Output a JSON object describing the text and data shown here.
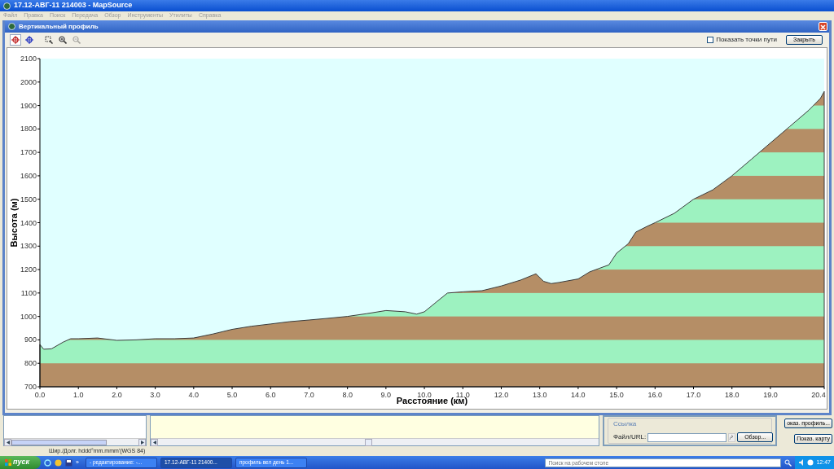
{
  "window": {
    "title": "17.12-АВГ-11 214003 - MapSource"
  },
  "menu": [
    "Файл",
    "Правка",
    "Поиск",
    "Передача",
    "Обзор",
    "Инструменты",
    "Утилиты",
    "Справка"
  ],
  "dialog": {
    "title": "Вертикальный профиль",
    "tools": [
      {
        "kind": "select",
        "selected": true,
        "disabled": false
      },
      {
        "kind": "move",
        "selected": false,
        "disabled": false
      },
      {
        "kind": "zoombox",
        "selected": false,
        "disabled": false
      },
      {
        "kind": "zoomin",
        "selected": false,
        "disabled": false
      },
      {
        "kind": "zoomout",
        "selected": false,
        "disabled": true
      }
    ],
    "show_waypoints": {
      "label": "Показать точки пути",
      "checked": false
    },
    "close_button": "Закрыть",
    "chart_data": {
      "type": "area",
      "xlabel": "Расстояние  (км)",
      "ylabel": "Высота (м)",
      "x": [
        0.0,
        0.1,
        0.3,
        0.6,
        0.8,
        1.0,
        1.5,
        2.0,
        2.5,
        3.0,
        3.5,
        4.0,
        4.5,
        5.0,
        5.5,
        6.0,
        6.5,
        7.0,
        7.5,
        8.0,
        8.5,
        9.0,
        9.5,
        9.8,
        10.0,
        10.3,
        10.6,
        11.0,
        11.5,
        12.0,
        12.5,
        12.9,
        13.1,
        13.3,
        13.5,
        14.0,
        14.3,
        14.8,
        15.0,
        15.3,
        15.5,
        15.8,
        16.0,
        16.5,
        17.0,
        17.5,
        18.0,
        18.5,
        19.0,
        19.5,
        20.0,
        20.3,
        20.4
      ],
      "series": [
        {
          "color": "#3a3a3a",
          "values": [
            880,
            860,
            862,
            890,
            905,
            905,
            908,
            898,
            900,
            905,
            905,
            908,
            925,
            945,
            958,
            968,
            978,
            985,
            992,
            1000,
            1012,
            1025,
            1020,
            1010,
            1020,
            1060,
            1100,
            1105,
            1110,
            1130,
            1155,
            1182,
            1150,
            1140,
            1145,
            1160,
            1190,
            1220,
            1270,
            1310,
            1360,
            1385,
            1400,
            1440,
            1500,
            1540,
            1600,
            1670,
            1740,
            1810,
            1880,
            1930,
            1960
          ]
        }
      ],
      "xlim": [
        0,
        20.4
      ],
      "ylim": [
        700,
        2100
      ],
      "xticks": [
        {
          "value": 0,
          "label": "0.0"
        },
        {
          "value": 1,
          "label": "1.0"
        },
        {
          "value": 2,
          "label": "2.0"
        },
        {
          "value": 3,
          "label": "3.0"
        },
        {
          "value": 4,
          "label": "4.0"
        },
        {
          "value": 5,
          "label": "5.0"
        },
        {
          "value": 6,
          "label": "6.0"
        },
        {
          "value": 7,
          "label": "7.0"
        },
        {
          "value": 8,
          "label": "8.0"
        },
        {
          "value": 9,
          "label": "9.0"
        },
        {
          "value": 10,
          "label": "10.0"
        },
        {
          "value": 11,
          "label": "11.0"
        },
        {
          "value": 12,
          "label": "12.0"
        },
        {
          "value": 13,
          "label": "13.0"
        },
        {
          "value": 14,
          "label": "14.0"
        },
        {
          "value": 15,
          "label": "15.0"
        },
        {
          "value": 16,
          "label": "16.0"
        },
        {
          "value": 17,
          "label": "17.0"
        },
        {
          "value": 18,
          "label": "18.0"
        },
        {
          "value": 19,
          "label": "19.0"
        },
        {
          "value": 20.4,
          "label": "20.4"
        }
      ],
      "yticks": [
        700,
        800,
        900,
        1000,
        1100,
        1200,
        1300,
        1400,
        1500,
        1600,
        1700,
        1800,
        1900,
        2000,
        2100
      ]
    }
  },
  "link_panel": {
    "title": "Ссылка",
    "field_label": "Файл/URL:",
    "browse_button": "Обзор..."
  },
  "side_buttons": [
    "оказ. профиль...",
    "Показ. карту"
  ],
  "status_bar": "Шир./Долг. hddd°mm.mmm'(WGS 84)",
  "taskbar": {
    "start": "пуск",
    "quick_launch_more": "»",
    "tasks": [
      {
        "label": "- редактирование: -...",
        "selected": false
      },
      {
        "label": "17.12-АВГ-11 21400...",
        "selected": true
      },
      {
        "label": "профиль вел день 1...",
        "selected": false
      }
    ],
    "search_placeholder": "Поиск на рабочем столе",
    "clock": "12:47"
  }
}
